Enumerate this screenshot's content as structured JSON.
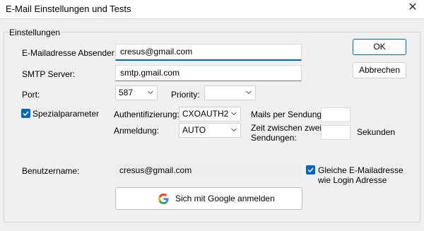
{
  "window": {
    "title": "E-Mail Einstellungen und Tests",
    "close_glyph": "✕"
  },
  "group": {
    "label": "Einstellungen"
  },
  "fields": {
    "sender_label": "E-Mailadresse Absender:",
    "sender_value": "cresus@gmail.com",
    "smtp_label": "SMTP Server:",
    "smtp_value": "smtp.gmail.com",
    "port_label": "Port:",
    "port_value": "587",
    "priority_label": "Priority:",
    "priority_value": ""
  },
  "special": {
    "checkbox_label": "Spezialparameter",
    "checked": true,
    "auth_label": "Authentifizierung:",
    "auth_value": "CXOAUTH2",
    "login_label": "Anmeldung:",
    "login_value": "AUTO",
    "mails_label": "Mails per Sendung:",
    "mails_value": "",
    "interval_label_line1": "Zeit zwischen zwei",
    "interval_label_line2": "Sendungen:",
    "interval_value": "",
    "interval_unit": "Sekunden"
  },
  "account": {
    "username_label": "Benutzername:",
    "username_value": "cresus@gmail.com",
    "same_address_line1": "Gleiche E-Mailadresse",
    "same_address_line2": "wie Login Adresse",
    "same_address_checked": true,
    "google_button_label": "Sich mit Google anmelden"
  },
  "buttons": {
    "ok_label": "OK",
    "cancel_label": "Abbrechen"
  },
  "colors": {
    "accent": "#0067c0",
    "dialog_bg": "#f0f0f0"
  },
  "icons": {
    "close": "close-icon",
    "dropdown": "chevron-down-icon",
    "check": "checkmark-icon",
    "google": "google-logo-icon"
  }
}
